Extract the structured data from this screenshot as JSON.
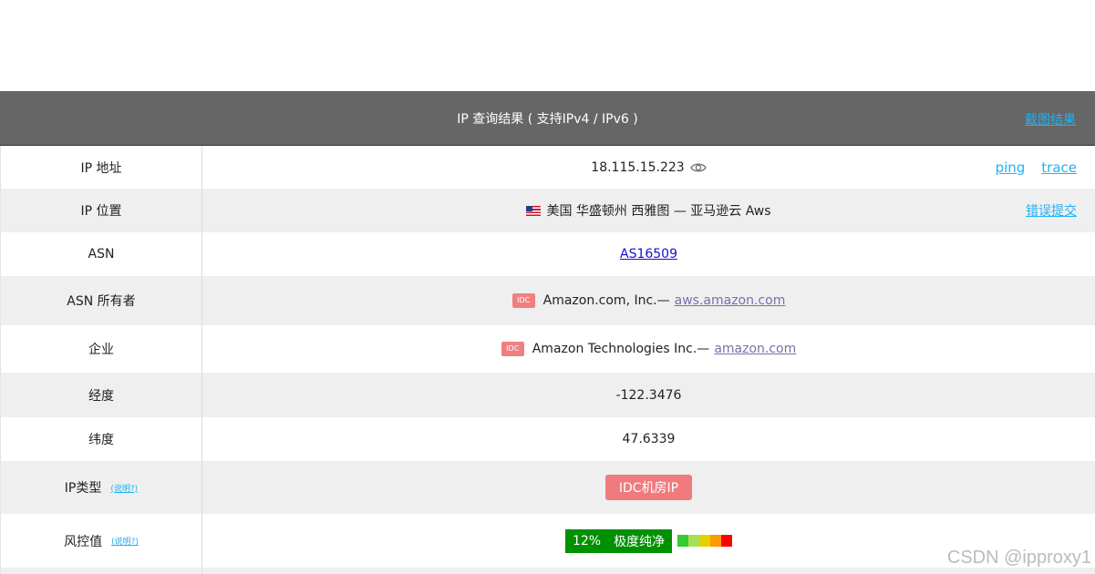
{
  "header": {
    "title": "IP 查询结果 ( 支持IPv4 / IPv6 )",
    "screenshot_link": "截图结果"
  },
  "rows": {
    "ip": {
      "label": "IP 地址",
      "value": "18.115.15.223",
      "links": [
        "ping",
        "trace"
      ]
    },
    "location": {
      "label": "IP 位置",
      "value": "美国 华盛顿州 西雅图 — 亚马逊云 Aws",
      "link": "错误提交"
    },
    "asn": {
      "label": "ASN",
      "value": "AS16509"
    },
    "asn_owner": {
      "label": "ASN 所有者",
      "badge": "IDC",
      "value": "Amazon.com, Inc.—",
      "link": "aws.amazon.com"
    },
    "company": {
      "label": "企业",
      "badge": "IDC",
      "value": "Amazon Technologies Inc.—",
      "link": "amazon.com"
    },
    "longitude": {
      "label": "经度",
      "value": "-122.3476"
    },
    "latitude": {
      "label": "纬度",
      "value": "47.6339"
    },
    "ip_type": {
      "label": "IP类型",
      "explain": "(说明?)",
      "value": "IDC机房IP"
    },
    "risk": {
      "label": "风控值",
      "explain": "(说明?)",
      "percent": "12%",
      "level": "极度纯净"
    }
  },
  "colors": {
    "header_bg": "#666666",
    "link": "#1fb1f5",
    "risk_good": "#009100",
    "risk_scale": [
      "#33cc33",
      "#a6e05a",
      "#e6d200",
      "#ff9900",
      "#ff0000"
    ]
  },
  "watermark": "CSDN @ipproxy1"
}
